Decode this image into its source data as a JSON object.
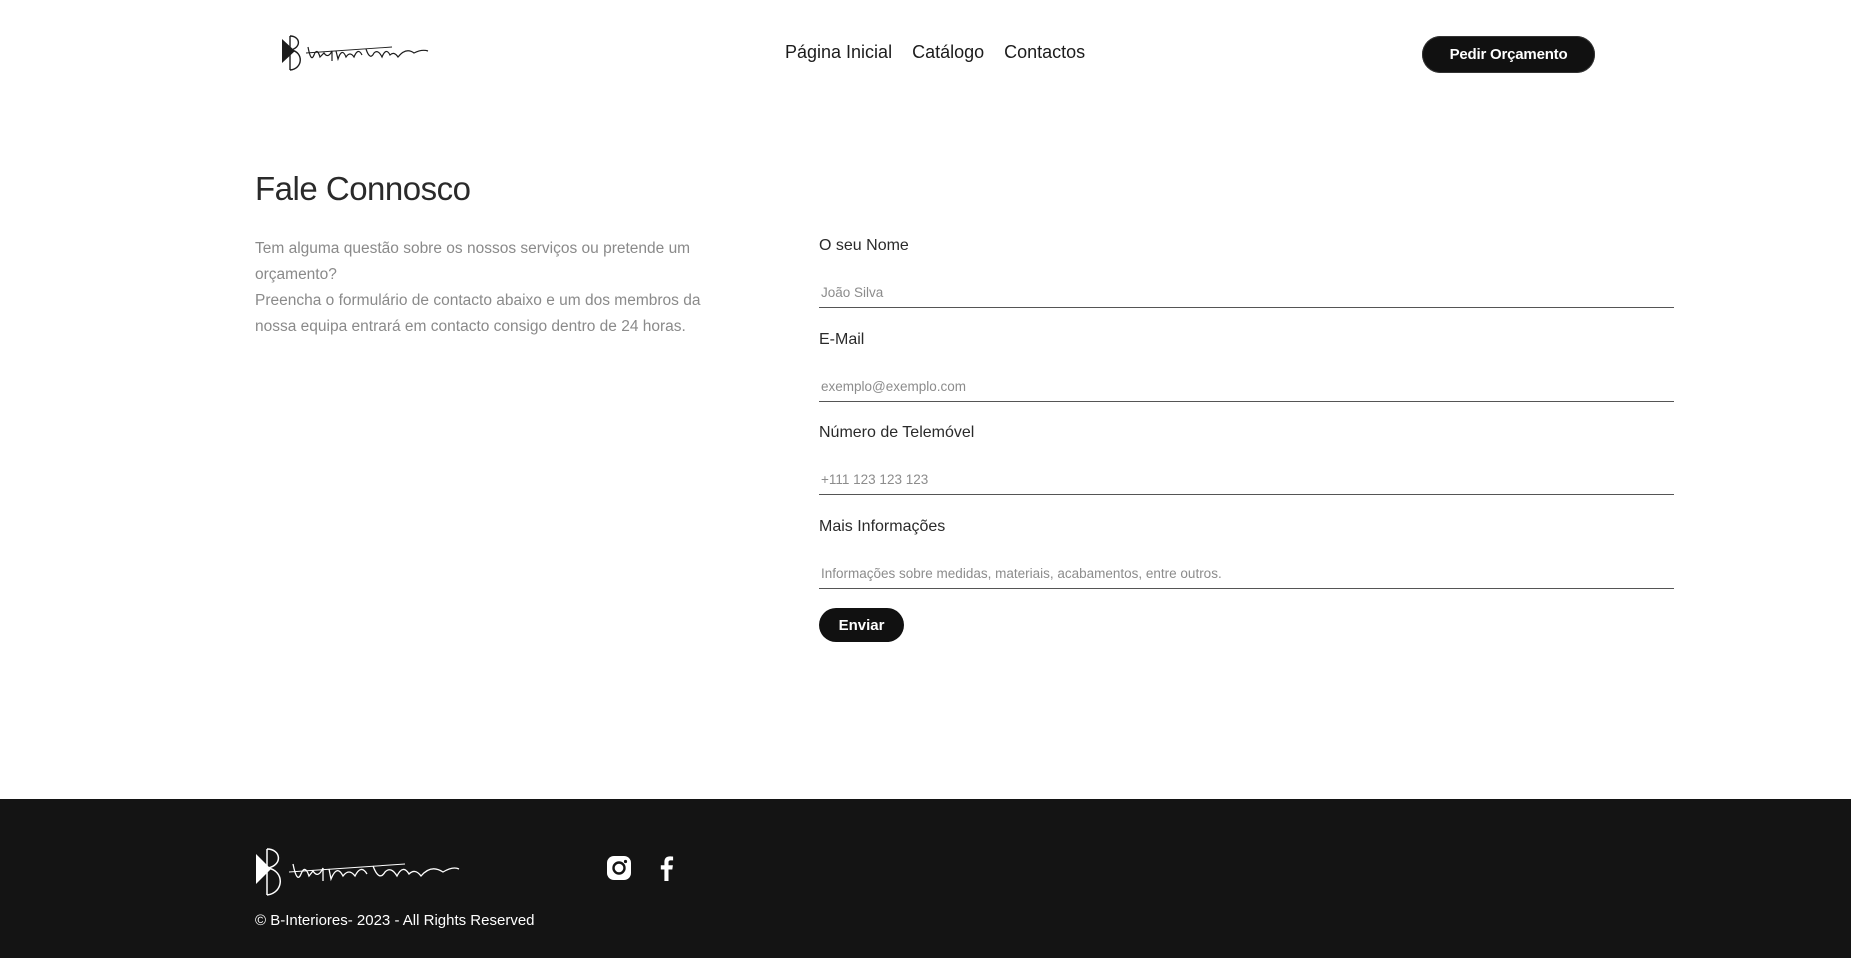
{
  "header": {
    "logo_text": "B interiores",
    "nav": [
      {
        "label": "Página Inicial"
      },
      {
        "label": "Catálogo"
      },
      {
        "label": "Contactos"
      }
    ],
    "cta_label": "Pedir Orçamento"
  },
  "main": {
    "title": "Fale Connosco",
    "intro_line1": "Tem alguma questão sobre os nossos serviços ou pretende um orçamento?",
    "intro_line2": "Preencha o formulário de contacto abaixo e um dos membros da nossa equipa entrará em contacto consigo dentro de 24 horas."
  },
  "form": {
    "fields": [
      {
        "label": "O seu Nome",
        "placeholder": "João Silva",
        "value": ""
      },
      {
        "label": "E-Mail",
        "placeholder": "exemplo@exemplo.com",
        "value": ""
      },
      {
        "label": "Número de Telemóvel",
        "placeholder": "+111 123 123 123",
        "value": ""
      },
      {
        "label": "Mais Informações",
        "placeholder": "Informações sobre medidas, materiais, acabamentos, entre outros.",
        "value": ""
      }
    ],
    "submit_label": "Enviar"
  },
  "footer": {
    "logo_text": "B interiores",
    "socials": [
      {
        "icon": "instagram-icon"
      },
      {
        "icon": "facebook-icon"
      }
    ],
    "copyright": "© B-Interiores- 2023 - All Rights Reserved"
  },
  "colors": {
    "accent": "#111111",
    "footer_bg": "#141414",
    "muted_text": "#8a8a8a"
  }
}
